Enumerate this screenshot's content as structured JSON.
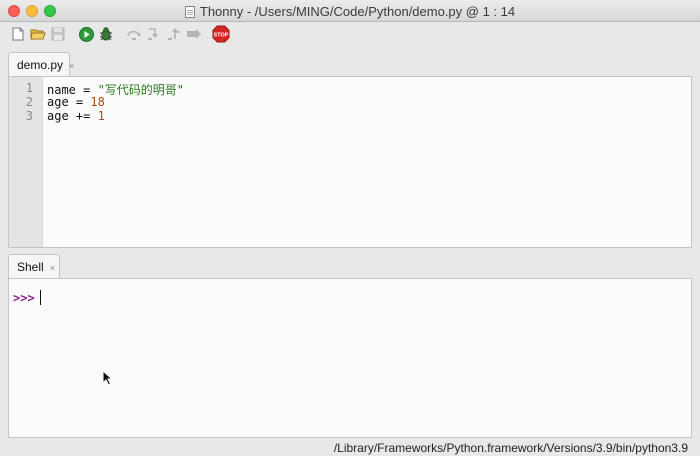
{
  "window": {
    "title": "Thonny  -  /Users/MING/Code/Python/demo.py  @  1 : 14"
  },
  "toolbar": {
    "buttons": [
      {
        "icon": "new-file-icon",
        "enabled": true
      },
      {
        "icon": "open-file-icon",
        "enabled": true
      },
      {
        "icon": "save-icon",
        "enabled": false
      },
      {
        "icon": "run-icon",
        "enabled": true
      },
      {
        "icon": "debug-icon",
        "enabled": true
      },
      {
        "icon": "step-over-icon",
        "enabled": false
      },
      {
        "icon": "step-into-icon",
        "enabled": false
      },
      {
        "icon": "step-out-icon",
        "enabled": false
      },
      {
        "icon": "resume-icon",
        "enabled": false
      },
      {
        "icon": "stop-icon",
        "enabled": true,
        "label": "STOP"
      }
    ]
  },
  "editor": {
    "tab_label": "demo.py",
    "tab_close": "×",
    "lines": [
      {
        "number": "1",
        "text": "name = \"写代码的明哥\""
      },
      {
        "number": "2",
        "text": "age = 18"
      },
      {
        "number": "3",
        "text": "age += 1"
      }
    ]
  },
  "shell": {
    "tab_label": "Shell",
    "tab_close": "×",
    "prompt": ">>>"
  },
  "statusbar": {
    "interpreter_path": "/Library/Frameworks/Python.framework/Versions/3.9/bin/python3.9"
  },
  "colors": {
    "string": "#2b7a1f",
    "number": "#b04a10",
    "prompt": "#8a1e87",
    "run_green": "#2e9b3a",
    "stop_red": "#d5261f"
  }
}
